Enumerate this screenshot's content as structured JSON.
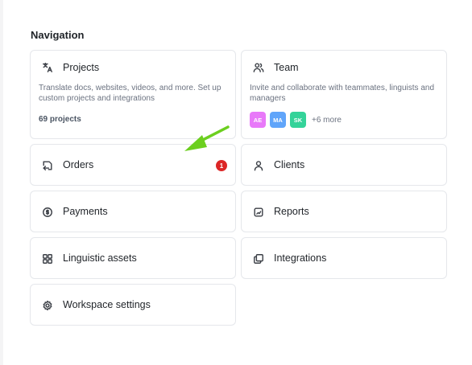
{
  "section_title": "Navigation",
  "colors": {
    "badge": "#dc2626",
    "arrow": "#6ccf1f",
    "avatar_ae": "#e879f9",
    "avatar_ma": "#60a5fa",
    "avatar_sk": "#34d399"
  },
  "cards": {
    "projects": {
      "label": "Projects",
      "icon": "translate-icon",
      "description": "Translate docs, websites, videos, and more. Set up custom projects and integrations",
      "count": "69 projects"
    },
    "team": {
      "label": "Team",
      "icon": "users-icon",
      "description": "Invite and collaborate with teammates, linguists and managers",
      "avatars": [
        "AE",
        "MA",
        "SK"
      ],
      "more": "+6 more"
    },
    "orders": {
      "label": "Orders",
      "icon": "orders-icon",
      "badge": "1"
    },
    "clients": {
      "label": "Clients",
      "icon": "user-icon"
    },
    "payments": {
      "label": "Payments",
      "icon": "payment-icon"
    },
    "reports": {
      "label": "Reports",
      "icon": "report-icon"
    },
    "linguistic_assets": {
      "label": "Linguistic assets",
      "icon": "grid-icon"
    },
    "integrations": {
      "label": "Integrations",
      "icon": "integrations-icon"
    },
    "workspace_settings": {
      "label": "Workspace settings",
      "icon": "gear-icon"
    }
  }
}
